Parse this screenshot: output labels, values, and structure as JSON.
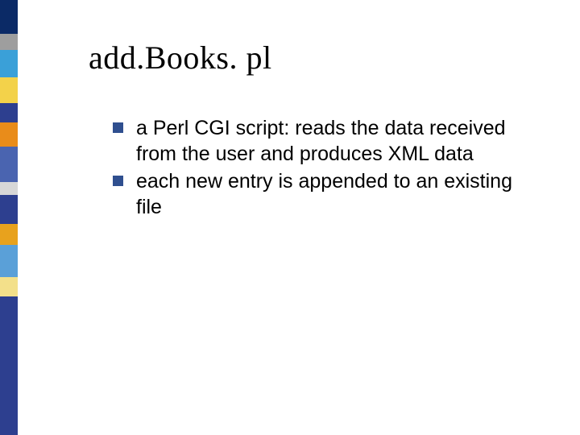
{
  "title": "add.Books. pl",
  "bullets": [
    "a Perl CGI script: reads the data received from the user and produces XML data",
    "each new entry is appended to an existing file"
  ],
  "sidebar_blocks": [
    {
      "color": "#0b2a66",
      "h": 42
    },
    {
      "color": "#9e9e9e",
      "h": 20
    },
    {
      "color": "#3aa0d8",
      "h": 34
    },
    {
      "color": "#f3d24a",
      "h": 32
    },
    {
      "color": "#2d3f8f",
      "h": 24
    },
    {
      "color": "#e98c1a",
      "h": 30
    },
    {
      "color": "#4a64b0",
      "h": 44
    },
    {
      "color": "#d7d7d7",
      "h": 16
    },
    {
      "color": "#2d3f8f",
      "h": 36
    },
    {
      "color": "#e8a21d",
      "h": 26
    },
    {
      "color": "#5aa0d8",
      "h": 40
    },
    {
      "color": "#f3e08a",
      "h": 24
    },
    {
      "color": "#2d3f8f",
      "h": 172
    }
  ]
}
